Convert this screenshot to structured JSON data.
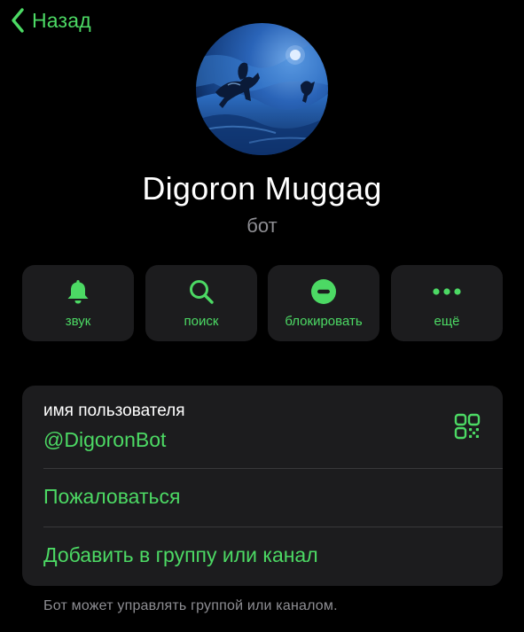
{
  "colors": {
    "accent": "#4cd964",
    "background": "#000000",
    "card": "#1c1c1e",
    "secondary_text": "#8e8e93",
    "primary_text": "#ffffff"
  },
  "nav": {
    "back_label": "Назад",
    "back_icon": "chevron-left-icon"
  },
  "profile": {
    "avatar_icon": "night-rider-avatar",
    "name": "Digoron Muggag",
    "subtitle": "бот"
  },
  "actions": [
    {
      "label": "звук",
      "icon": "bell-icon"
    },
    {
      "label": "поиск",
      "icon": "magnifier-icon"
    },
    {
      "label": "блокировать",
      "icon": "block-icon"
    },
    {
      "label": "ещё",
      "icon": "more-dots-icon"
    }
  ],
  "info": {
    "username_label": "имя пользователя",
    "username_value": "@DigoronBot",
    "qr_icon": "qr-code-icon",
    "report_label": "Пожаловаться",
    "add_label": "Добавить в группу или канал"
  },
  "footnote": "Бот может управлять группой или каналом."
}
